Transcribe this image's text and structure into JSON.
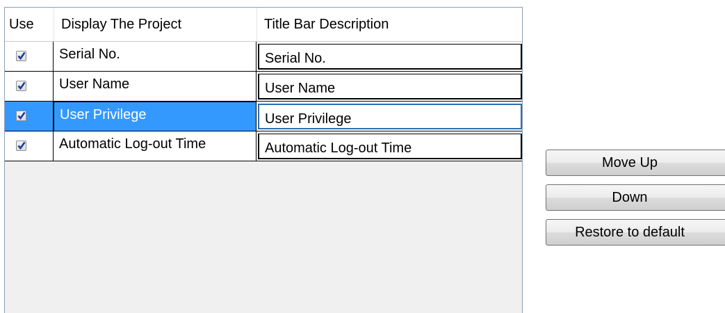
{
  "grid": {
    "headers": {
      "use": "Use",
      "project": "Display The Project",
      "title": "Title Bar Description"
    },
    "rows": [
      {
        "checked": true,
        "project": "Serial No.",
        "title": "Serial No."
      },
      {
        "checked": true,
        "project": "User Name",
        "title": "User Name"
      },
      {
        "checked": true,
        "project": "User Privilege",
        "title": "User Privilege",
        "selected": true
      },
      {
        "checked": true,
        "project": "Automatic Log-out Time",
        "title": "Automatic Log-out Time"
      }
    ]
  },
  "buttons": {
    "move_up": "Move Up",
    "down": "Down",
    "restore": "Restore to default"
  },
  "colors": {
    "selection": "#3399ff",
    "check": "#1a3d9e"
  },
  "icons": {
    "checkbox": "checked-checkbox-icon"
  }
}
